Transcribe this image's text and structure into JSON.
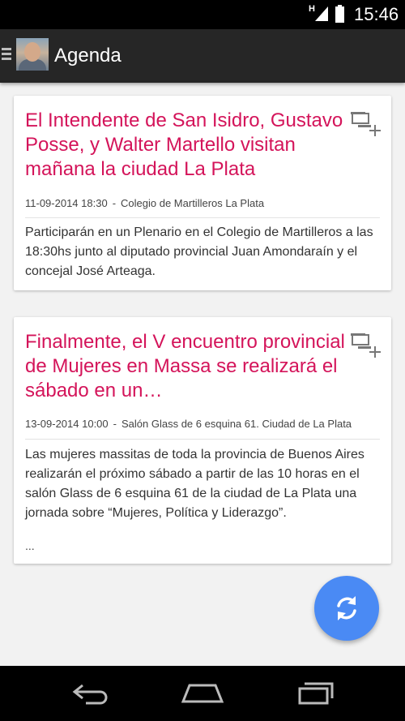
{
  "status_bar": {
    "network": "H",
    "time": "15:46",
    "icons": [
      "signal-icon",
      "battery-icon"
    ]
  },
  "action_bar": {
    "title": "Agenda",
    "icons": [
      "drawer-menu-icon",
      "avatar"
    ]
  },
  "cards": [
    {
      "title": "El Intendente de San Isidro, Gustavo Posse, y Walter Martello visitan mañana la ciudad La Plata",
      "date": "11-09-2014 18:30",
      "separator": "-",
      "location": "Colegio de Martilleros La Plata",
      "body": "Participarán en un Plenario en el Colegio de Martilleros a las 18:30hs junto al diputado provincial Juan Amondaraín y el concejal José Arteaga.",
      "more": ""
    },
    {
      "title": "Finalmente, el V encuentro provincial de Mujeres en Massa se realizará el sábado en un…",
      "date": "13-09-2014 10:00",
      "separator": "-",
      "location": "Salón Glass de 6 esquina 61. Ciudad de La Plata",
      "body": "Las mujeres massitas de toda la provincia de Buenos Aires realizarán el próximo sábado a partir de las 10 horas en el salón Glass de 6 esquina 61 de la ciudad de La Plata una jornada sobre “Mujeres, Política y Liderazgo”.",
      "more": "..."
    }
  ],
  "fab": {
    "icon": "refresh-icon",
    "color": "#4a8af4"
  },
  "nav_bar": {
    "icons": [
      "back-icon",
      "home-icon",
      "recent-apps-icon"
    ]
  },
  "colors": {
    "title": "#d4145a",
    "action_bar": "#262626",
    "background": "#f2f2f2"
  }
}
